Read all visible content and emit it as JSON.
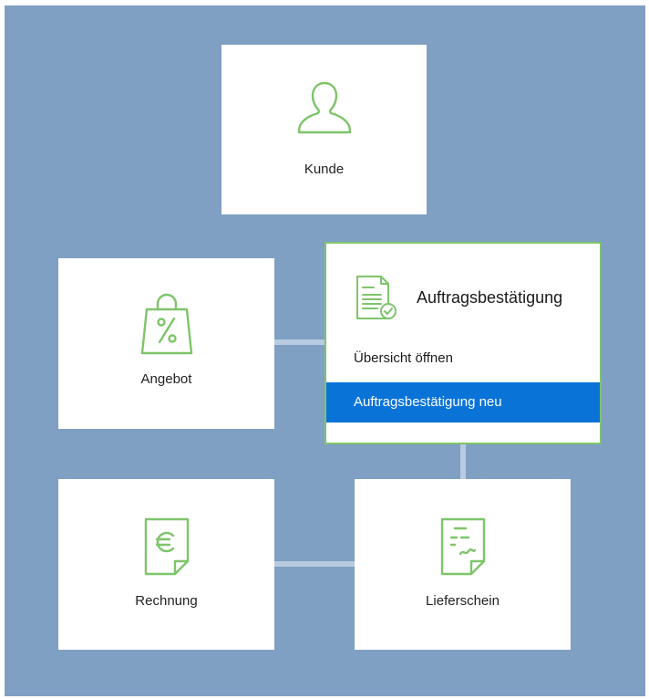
{
  "cards": {
    "kunde": {
      "label": "Kunde",
      "icon": "person-icon"
    },
    "angebot": {
      "label": "Angebot",
      "icon": "shopping-bag-percent-icon"
    },
    "rechnung": {
      "label": "Rechnung",
      "icon": "euro-document-icon"
    },
    "lieferschein": {
      "label": "Lieferschein",
      "icon": "delivery-note-icon"
    }
  },
  "menu": {
    "title": "Auftragsbestätigung",
    "icon": "order-confirmation-icon",
    "items": [
      {
        "label": "Übersicht öffnen",
        "selected": false
      },
      {
        "label": "Auftragsbestätigung neu",
        "selected": true
      }
    ]
  },
  "colors": {
    "background": "#7f9fc3",
    "connector": "#b9cbe0",
    "icon_green": "#7ec46a",
    "selected_item": "#0a73d8"
  }
}
